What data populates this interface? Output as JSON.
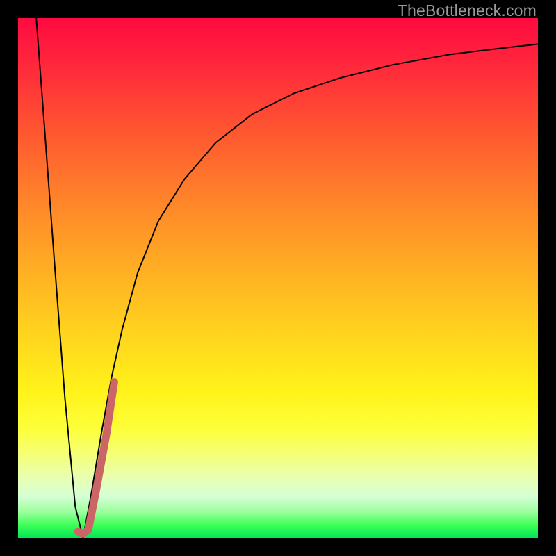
{
  "watermark": "TheBottleneck.com",
  "chart_data": {
    "type": "line",
    "title": "",
    "xlabel": "",
    "ylabel": "",
    "xlim": [
      0,
      100
    ],
    "ylim": [
      0,
      100
    ],
    "grid": false,
    "series": [
      {
        "name": "curve-black-left",
        "color": "#000000",
        "width": 2,
        "x": [
          3.5,
          5,
          7,
          9,
          11,
          12.5
        ],
        "y": [
          100,
          80,
          53,
          27,
          6,
          0
        ]
      },
      {
        "name": "curve-black-right",
        "color": "#000000",
        "width": 2,
        "x": [
          12.5,
          14,
          16,
          18,
          20,
          23,
          27,
          32,
          38,
          45,
          53,
          62,
          72,
          83,
          93,
          100
        ],
        "y": [
          0,
          8,
          20,
          31,
          40,
          51,
          61,
          69,
          76,
          81.5,
          85.5,
          88.5,
          91,
          93,
          94.2,
          95
        ]
      },
      {
        "name": "highlight-segment",
        "color": "#cc6666",
        "width": 11,
        "linecap": "round",
        "x": [
          11.5,
          12.5,
          13.5,
          15,
          17,
          18.5
        ],
        "y": [
          1.2,
          0.8,
          1.5,
          9,
          20,
          30
        ]
      }
    ],
    "background_gradient": {
      "top_color": "#ff0a40",
      "mid_color": "#ffd21e",
      "bottom_color": "#00e755"
    }
  }
}
